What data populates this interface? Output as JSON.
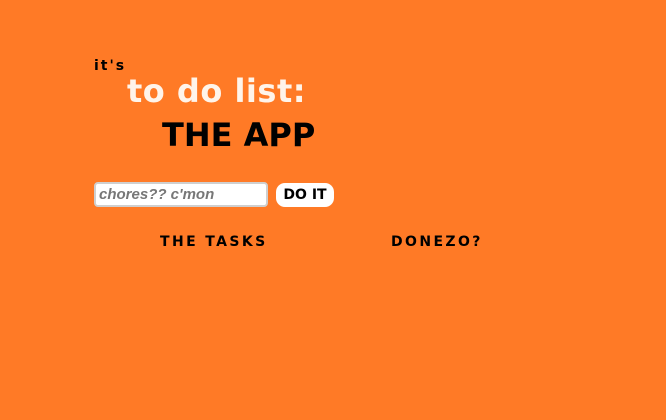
{
  "header": {
    "pre_title": "it's",
    "title": "to do list:",
    "subtitle": "THE APP"
  },
  "form": {
    "input_placeholder": "chores?? c'mon",
    "input_value": "",
    "submit_label": "DO IT"
  },
  "columns": {
    "tasks_header": "THE TASKS",
    "done_header": "DONEZO?"
  },
  "colors": {
    "background": "#ff7a26",
    "title": "#fff4ea",
    "text": "#000000"
  }
}
